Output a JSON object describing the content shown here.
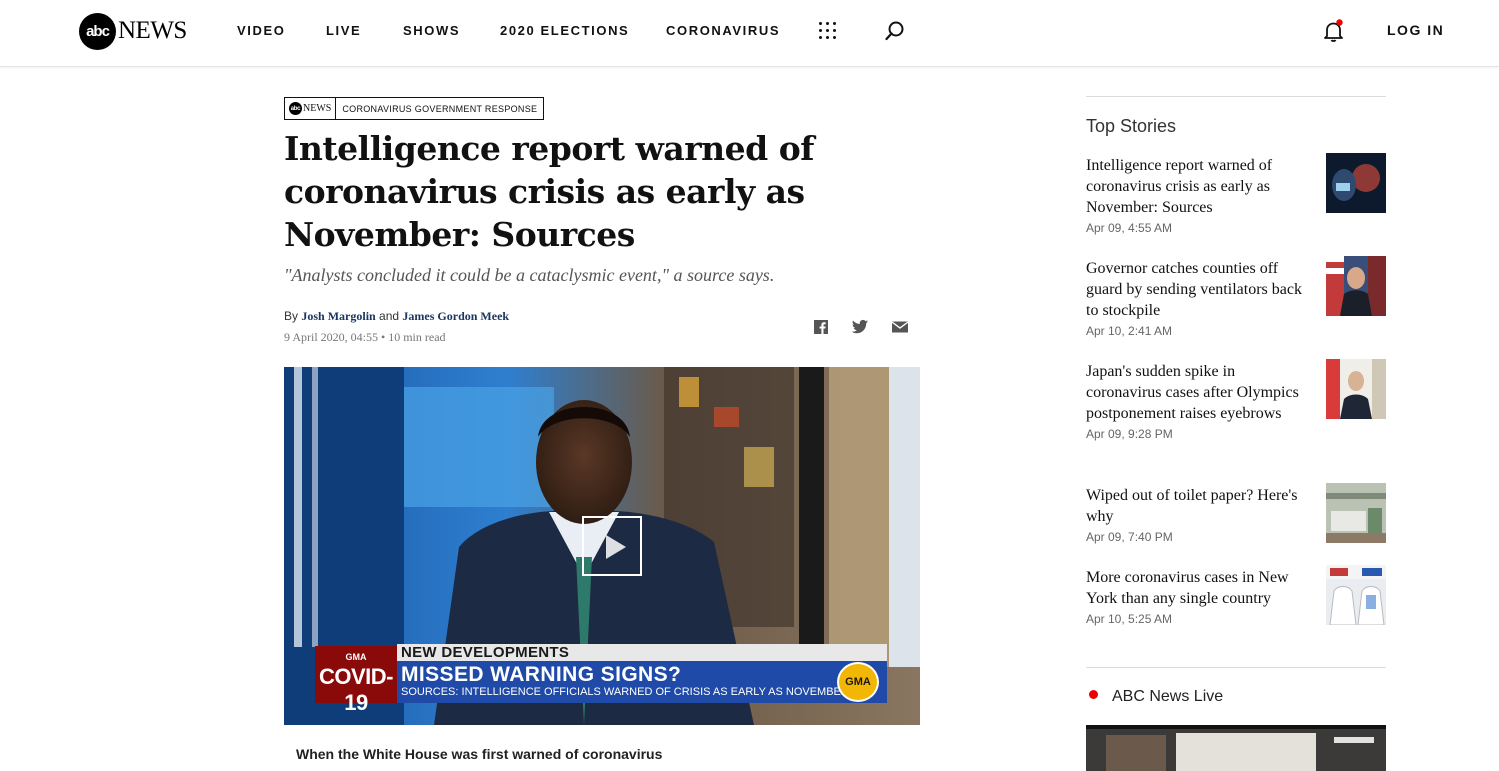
{
  "header": {
    "logo_abc": "abc",
    "logo_news": "NEWS",
    "nav": [
      "VIDEO",
      "LIVE",
      "SHOWS",
      "2020 ELECTIONS",
      "CORONAVIRUS"
    ],
    "login_label": "LOG IN"
  },
  "article": {
    "tag_logo_abc": "abc",
    "tag_logo_news": "NEWS",
    "tag_label": "CORONAVIRUS GOVERNMENT RESPONSE",
    "headline": "Intelligence report warned of coronavirus crisis as early as November: Sources",
    "subhead": "\"Analysts concluded it could be a cataclysmic event,\" a source says.",
    "byline_prefix": "By",
    "author1": "Josh Margolin",
    "byline_and": "and",
    "author2": "James Gordon Meek",
    "date": "9 April 2020, 04:55",
    "read_time": "• 10 min read",
    "video": {
      "chyron_top": "NEW DEVELOPMENTS",
      "chyron_title": "MISSED WARNING SIGNS?",
      "chyron_sub": "SOURCES: INTELLIGENCE OFFICIALS WARNED OF CRISIS AS EARLY AS NOVEMBER",
      "covid_gma": "GMA",
      "covid_label": "COVID-19",
      "gma_badge": "GMA"
    },
    "caption": "When the White House was first warned of coronavirus"
  },
  "sidebar": {
    "title": "Top Stories",
    "stories": [
      {
        "title": "Intelligence report warned of coronavirus crisis as early as November: Sources",
        "time": "Apr 09, 4:55 AM"
      },
      {
        "title": "Governor catches counties off guard by sending ventilators back to stockpile",
        "time": "Apr 10, 2:41 AM"
      },
      {
        "title": "Japan's sudden spike in coronavirus cases after Olympics postponement raises eyebrows",
        "time": "Apr 09, 9:28 PM"
      },
      {
        "title": "Wiped out of toilet paper? Here's why",
        "time": "Apr 09, 7:40 PM"
      },
      {
        "title": "More coronavirus cases in New York than any single country",
        "time": "Apr 10, 5:25 AM"
      }
    ],
    "live_title": "ABC News Live"
  }
}
